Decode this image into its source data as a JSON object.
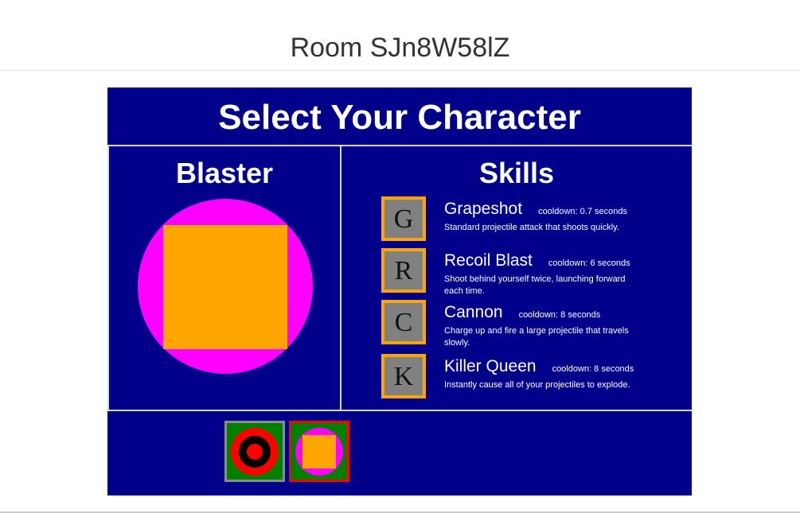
{
  "room": {
    "title": "Room SJn8W58lZ"
  },
  "game": {
    "title": "Select Your Character",
    "selected_character": {
      "name": "Blaster",
      "shape_icon": "magenta-circle-orange-square"
    },
    "skills_title": "Skills",
    "skills": [
      {
        "key": "G",
        "name": "Grapeshot",
        "cooldown": "cooldown: 0.7 seconds",
        "description": "Standard projectile attack that shoots quickly."
      },
      {
        "key": "R",
        "name": "Recoil Blast",
        "cooldown": "cooldown: 6 seconds",
        "description": "Shoot behind yourself twice, launching forward each time."
      },
      {
        "key": "C",
        "name": "Cannon",
        "cooldown": "cooldown: 8 seconds",
        "description": "Charge up and fire a large projectile that travels slowly."
      },
      {
        "key": "K",
        "name": "Killer Queen",
        "cooldown": "cooldown: 8 seconds",
        "description": "Instantly cause all of your projectiles to explode."
      }
    ],
    "character_options": [
      {
        "icon": "target-rings-icon",
        "selected": false
      },
      {
        "icon": "blaster-icon",
        "selected": true
      }
    ],
    "colors": {
      "background": "#00008b",
      "accent": "#ffa500",
      "magenta": "#ff00ff",
      "selected_border": "#ff0000",
      "option_background": "#008000"
    }
  }
}
